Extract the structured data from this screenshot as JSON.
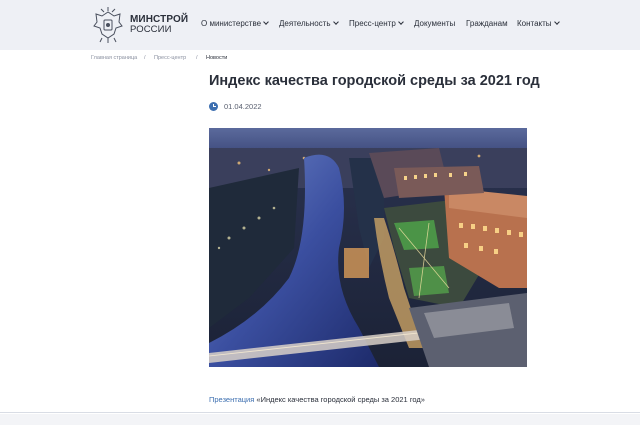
{
  "header": {
    "logo_line1": "МИНСТРОЙ",
    "logo_line2": "РОССИИ",
    "nav": [
      {
        "label": "О министерстве",
        "dropdown": true
      },
      {
        "label": "Деятельность",
        "dropdown": true
      },
      {
        "label": "Пресс-центр",
        "dropdown": true
      },
      {
        "label": "Документы",
        "dropdown": false
      },
      {
        "label": "Гражданам",
        "dropdown": false
      },
      {
        "label": "Контакты",
        "dropdown": true
      }
    ]
  },
  "breadcrumb": {
    "home": "Главная страница",
    "section": "Пресс-центр",
    "current": "Новости",
    "separator": "/"
  },
  "article": {
    "title": "Индекс качества городской среды за 2021 год",
    "date": "01.04.2022",
    "caption_link": "Презентация",
    "caption_text": " «Индекс качества городской среды за 2021 год»"
  },
  "colors": {
    "header_bg": "#eef0f5",
    "accent": "#3d6fb0",
    "text": "#2a2f3a"
  }
}
